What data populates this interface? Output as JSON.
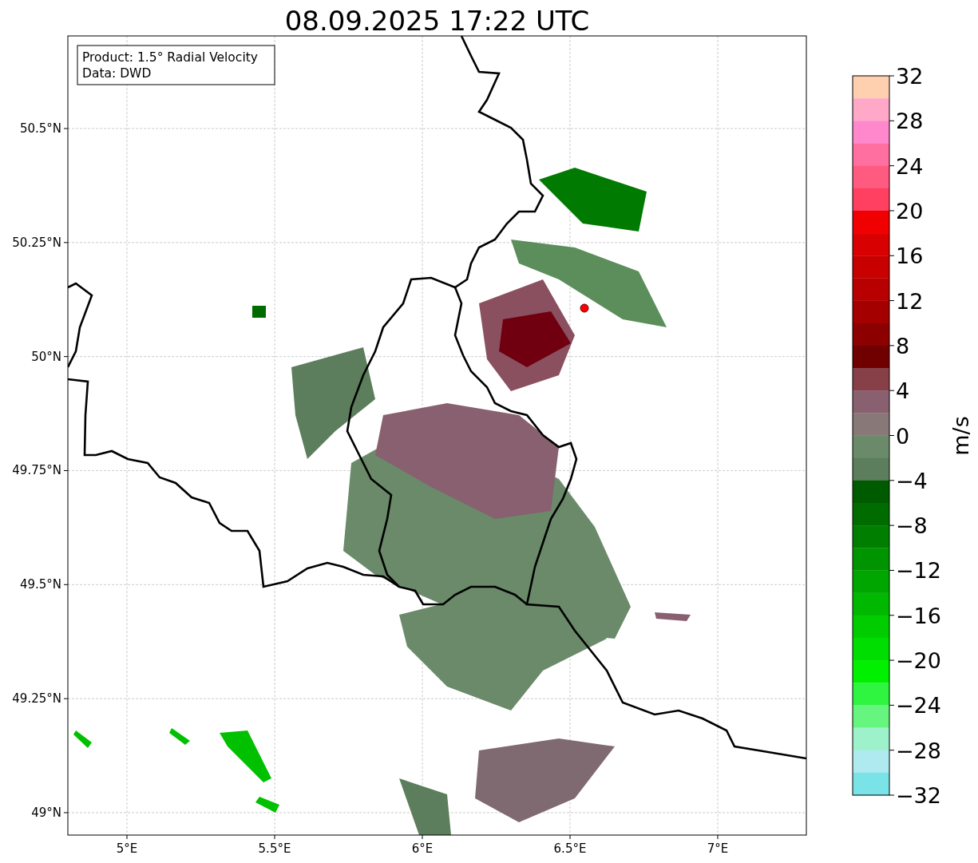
{
  "title": "08.09.2025 17:22 UTC",
  "annotation": [
    "Product: 1.5° Radial Velocity",
    "Data: DWD"
  ],
  "lat_ticks": [
    "50.5°N",
    "50.25°N",
    "50°N",
    "49.75°N",
    "49.5°N",
    "49.25°N",
    "49°N"
  ],
  "lon_ticks": [
    "5°E",
    "5.5°E",
    "6°E",
    "6.5°E",
    "7°E"
  ],
  "colorbar": {
    "label": "m/s",
    "ticks": [
      "32",
      "28",
      "24",
      "20",
      "16",
      "12",
      "8",
      "4",
      "0",
      "−4",
      "−8",
      "−12",
      "−16",
      "−20",
      "−24",
      "−28",
      "−32"
    ],
    "bands": [
      {
        "color": "#ffd0b0"
      },
      {
        "color": "#ffa8c8"
      },
      {
        "color": "#ff88cc"
      },
      {
        "color": "#ff70a0"
      },
      {
        "color": "#ff5a80"
      },
      {
        "color": "#ff4060"
      },
      {
        "color": "#f00000"
      },
      {
        "color": "#d80000"
      },
      {
        "color": "#c80000"
      },
      {
        "color": "#b80000"
      },
      {
        "color": "#a40000"
      },
      {
        "color": "#8c0000"
      },
      {
        "color": "#700000"
      },
      {
        "color": "#884048"
      },
      {
        "color": "#886070"
      },
      {
        "color": "#887878"
      },
      {
        "color": "#6a8a6a"
      },
      {
        "color": "#5c7e5c"
      },
      {
        "color": "#005a00"
      },
      {
        "color": "#006c00"
      },
      {
        "color": "#007e00"
      },
      {
        "color": "#009400"
      },
      {
        "color": "#00a600"
      },
      {
        "color": "#00b800"
      },
      {
        "color": "#00cc00"
      },
      {
        "color": "#00dd00"
      },
      {
        "color": "#00f000"
      },
      {
        "color": "#30f540"
      },
      {
        "color": "#66f57f"
      },
      {
        "color": "#9ef2cb"
      },
      {
        "color": "#aeeaef"
      },
      {
        "color": "#7ae3e8"
      }
    ]
  }
}
